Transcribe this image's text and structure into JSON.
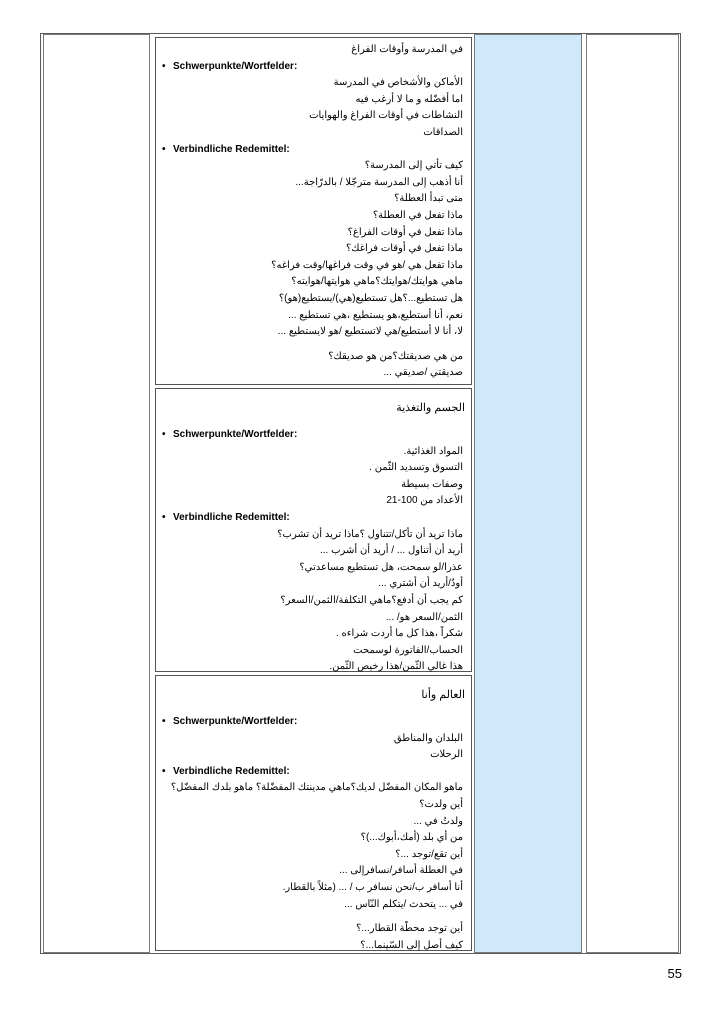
{
  "cell1": {
    "lines_top": [
      "في المدرسة وأوقات الفراغ"
    ],
    "heading_a": "Schwerpunkte/Wortfelder:",
    "lines_a": [
      "الأماكن والأشخاص في المدرسة",
      "اما أفضّله و ما لا أرغب فيه",
      "النشاطات في أوقات الفراغ والهوايات",
      "الصداقات"
    ],
    "heading_b": "Verbindliche Redemittel:",
    "lines_b": [
      "كيف تأتي إلى المدرسة؟",
      "أنا أذهب إلى المدرسة مترجّلا / بالدرّاجة...",
      "متى تبدأ العطلة؟",
      "ماذا تفعل في العطلة؟",
      "ماذا تفعل في أوقات الفراغ؟",
      "ماذا تفعل في أوقات فراغك؟",
      "ماذا تفعل هي /هو في وقت فراغها/وقت فراغه؟",
      "ماهي هوايتك/هوايتك؟ماهي هوايتها/هوايته؟",
      "هل تستطيع...؟هل تستطيع(هي)/يستطيع(هو)؟",
      "نعم، أنا أستطيع،هو يستطيع ،هي تستطيع ...",
      "لا، أنا لا أستطيع/هي لاتستطيع /هو لايستطيع ..."
    ],
    "lines_c": [
      "من هي صديقتك؟من هو صديقك؟",
      "صديقتي /صديقي ..."
    ]
  },
  "cell2": {
    "title": "الجسم والتغذية",
    "heading_a": "Schwerpunkte/Wortfelder:",
    "lines_a": [
      "المواد الغذائية.",
      "التسوق وتسديد الثّمن .",
      "وصفات بسيطة",
      "الأعداد من 100-21"
    ],
    "heading_b": "Verbindliche Redemittel:",
    "lines_b": [
      "ماذا تريد أن تأكل/تتناول ؟ماذا تريد أن تشرب؟",
      "أريد أن أتناول ... / أريد أن أشرب ...",
      "عذرا/لو سمحت، هل تستطيع مساعدتي؟",
      "أودُ/أريد أن أشتري ...",
      "كم يجب أن أدفع؟ماهي التكلفة/الثمن/السعر؟",
      "الثمن/السعر هو/ ...",
      "شكراً ،هذا كل ما أردت شراءه .",
      "الحساب/الفاتورة لوسمحت",
      "هذا غالي الثّمن/هذا رخيص الثّمن."
    ]
  },
  "cell3": {
    "title": "العالم وأنا",
    "heading_a": "Schwerpunkte/Wortfelder:",
    "lines_a": [
      "البلدان والمناطق",
      "الرحلات"
    ],
    "heading_b": "Verbindliche Redemittel:",
    "lines_b": [
      "ماهو المكان المفضّل لديك؟ماهي مدينتك المفضّلة؟ ماهو بلدك المفضّل؟",
      "أين ولدت؟",
      "ولدتُ في ...",
      "من أي بلد (أمك،أبوك...)؟",
      "أين تقع/توجد ...؟",
      "في العطلة أسافر/نسافرإلى ...",
      "أنا أسافر ب/نحن نسافر ب / ... (مثلاً بالقطار.",
      "في ... يتحدث /يتكلم النّاس ..."
    ],
    "lines_c": [
      "أين توجد محطّة القطار...؟",
      "كيف أصل إلى السّينما...؟"
    ]
  },
  "page_number": "55"
}
